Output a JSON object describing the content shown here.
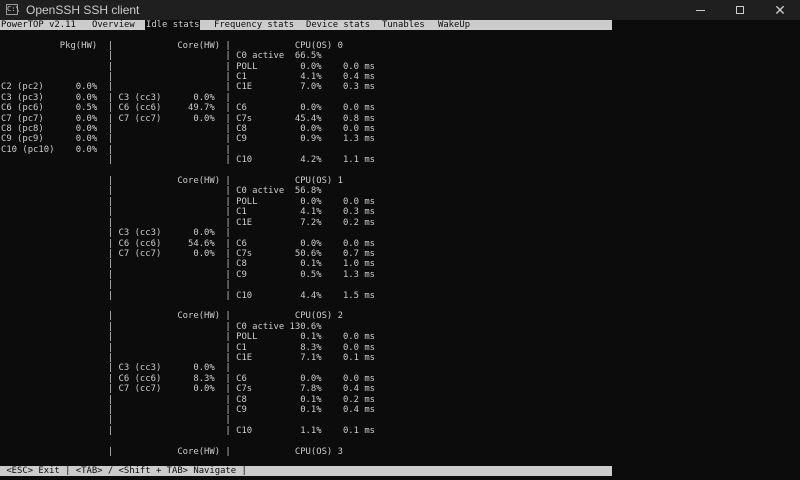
{
  "window": {
    "title": "OpenSSH SSH client",
    "icon": "terminal-icon"
  },
  "tabs": [
    {
      "label": "PowerTOP v2.11",
      "active": false
    },
    {
      "label": "Overview",
      "active": false
    },
    {
      "label": "Idle stats",
      "active": true
    },
    {
      "label": "Frequency stats",
      "active": false
    },
    {
      "label": "Device stats",
      "active": false
    },
    {
      "label": "Tunables",
      "active": false
    },
    {
      "label": "WakeUp",
      "active": false
    }
  ],
  "screen_text": "           Pkg(HW)  |            Core(HW) |            CPU(OS) 0\n                    |                     | C0 active  66.5%\n                    |                     | POLL        0.0%    0.0 ms\n                    |                     | C1          4.1%    0.4 ms\nC2 (pc2)      0.0%  |                     | C1E         7.0%    0.3 ms\nC3 (pc3)      0.0%  | C3 (cc3)      0.0%  |\nC6 (pc6)      0.5%  | C6 (cc6)     49.7%  | C6          0.0%    0.0 ms\nC7 (pc7)      0.0%  | C7 (cc7)      0.0%  | C7s        45.4%    0.8 ms\nC8 (pc8)      0.0%  |                     | C8          0.0%    0.0 ms\nC9 (pc9)      0.0%  |                     | C9          0.9%    1.3 ms\nC10 (pc10)    0.0%  |                     |\n                    |                     | C10         4.2%    1.1 ms\n\n                    |            Core(HW) |            CPU(OS) 1\n                    |                     | C0 active  56.8%\n                    |                     | POLL        0.0%    0.0 ms\n                    |                     | C1          4.1%    0.3 ms\n                    |                     | C1E         7.2%    0.2 ms\n                    | C3 (cc3)      0.0%  |\n                    | C6 (cc6)     54.6%  | C6          0.0%    0.0 ms\n                    | C7 (cc7)      0.0%  | C7s        50.6%    0.7 ms\n                    |                     | C8          0.1%    1.0 ms\n                    |                     | C9          0.5%    1.3 ms\n                    |                     |\n                    |                     | C10         4.4%    1.5 ms\n\n                    |            Core(HW) |            CPU(OS) 2\n                    |                     | C0 active 130.6%\n                    |                     | POLL        0.1%    0.0 ms\n                    |                     | C1          8.3%    0.0 ms\n                    |                     | C1E         7.1%    0.1 ms\n                    | C3 (cc3)      0.0%  |\n                    | C6 (cc6)      8.3%  | C6          0.0%    0.0 ms\n                    | C7 (cc7)      0.0%  | C7s         7.8%    0.4 ms\n                    |                     | C8          0.1%    0.2 ms\n                    |                     | C9          0.1%    0.4 ms\n                    |                     |\n                    |                     | C10         1.1%    0.1 ms\n\n                    |            Core(HW) |            CPU(OS) 3",
  "status_bar": " <ESC> Exit | <TAB> / <Shift + TAB> Navigate |"
}
